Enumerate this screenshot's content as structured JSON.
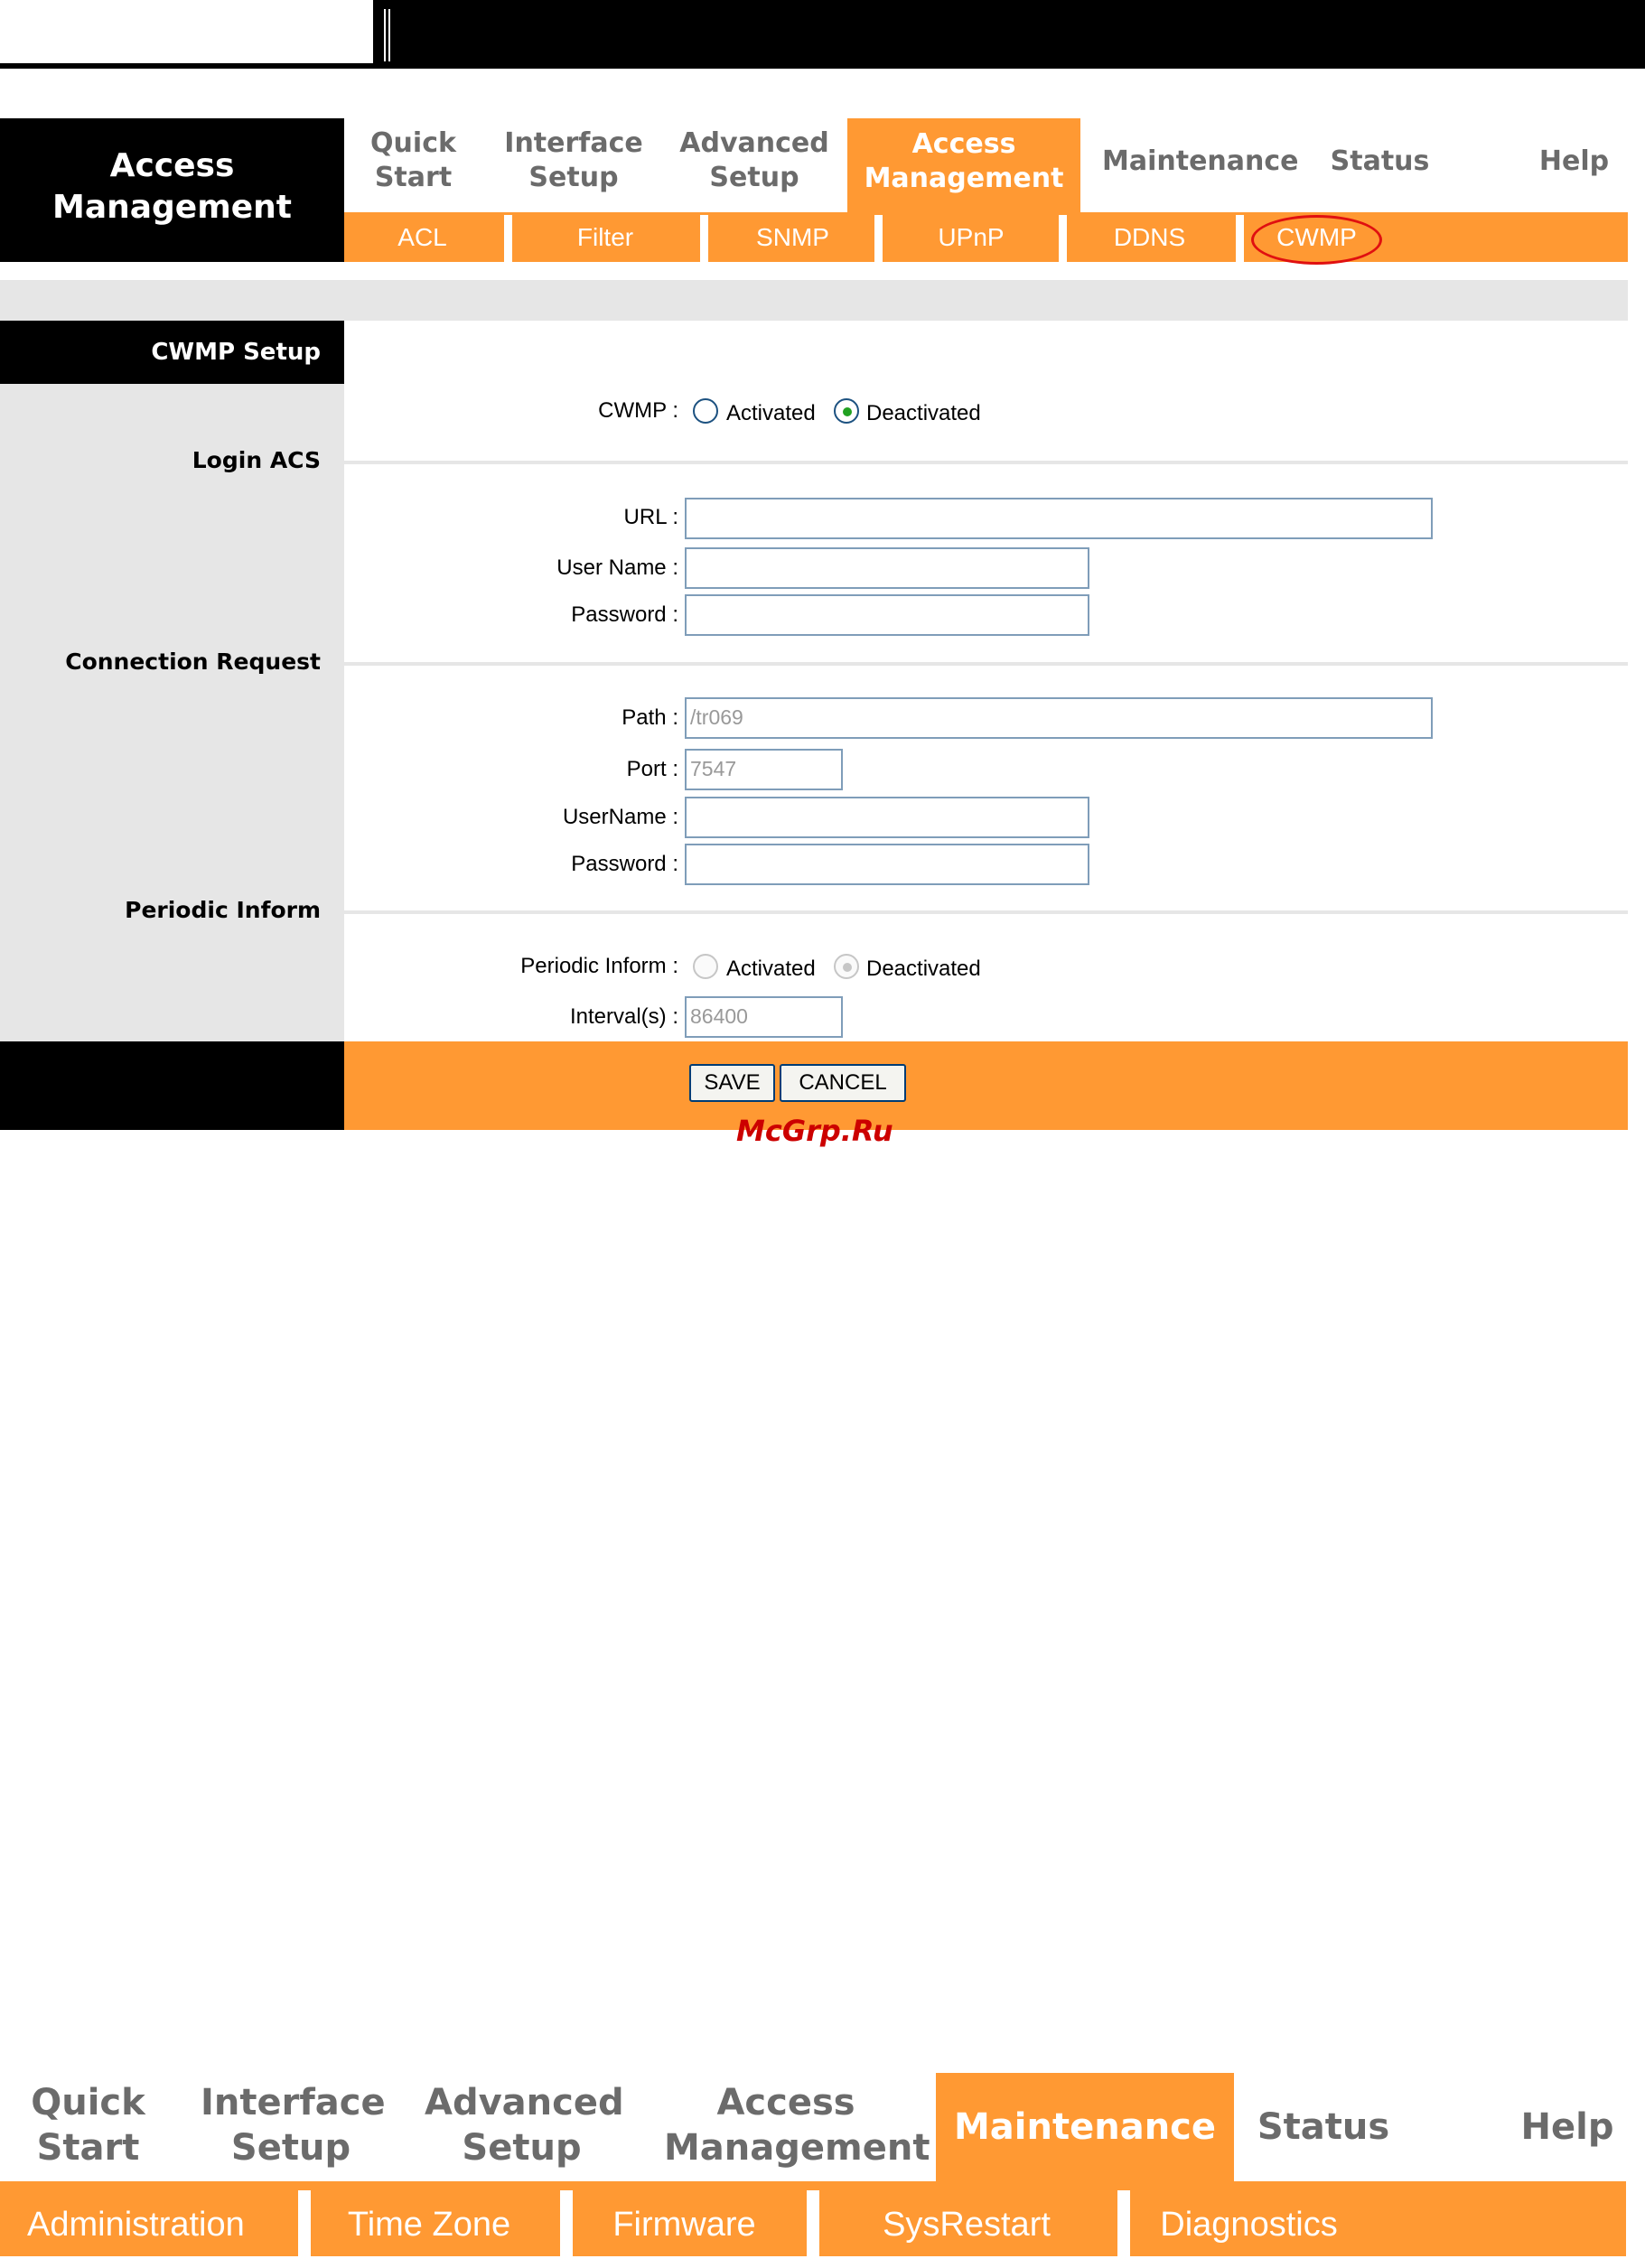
{
  "brand": {
    "line1": "Access",
    "line2": "Management"
  },
  "nav": {
    "quick_start": [
      "Quick",
      "Start"
    ],
    "interface_setup": [
      "Interface",
      "Setup"
    ],
    "advanced_setup": [
      "Advanced",
      "Setup"
    ],
    "access_management": [
      "Access",
      "Management"
    ],
    "maintenance": "Maintenance",
    "status": "Status",
    "help": "Help"
  },
  "subnav": [
    "ACL",
    "Filter",
    "SNMP",
    "UPnP",
    "DDNS",
    "CWMP"
  ],
  "panel": {
    "title": "CWMP Setup",
    "sections": {
      "login_acs": "Login ACS",
      "connection_request": "Connection Request",
      "periodic_inform": "Periodic Inform"
    },
    "cwmp_label": "CWMP :",
    "activated": "Activated",
    "deactivated": "Deactivated",
    "cwmp_selected": "Deactivated",
    "url_label": "URL :",
    "url_value": "",
    "username_label": "User Name :",
    "username_value": "",
    "password_label": "Password :",
    "password_value": "",
    "path_label": "Path :",
    "path_value": "/tr069",
    "port_label": "Port :",
    "port_value": "7547",
    "conn_username_label": "UserName :",
    "conn_username_value": "",
    "conn_password_label": "Password :",
    "conn_password_value": "",
    "periodic_label": "Periodic Inform :",
    "periodic_selected": "Deactivated",
    "interval_label": "Interval(s) :",
    "interval_value": "86400",
    "save": "SAVE",
    "cancel": "CANCEL"
  },
  "watermark": "McGrp.Ru",
  "nav2": {
    "quick_start": [
      "Quick",
      "Start"
    ],
    "interface_setup": [
      "Interface",
      "Setup"
    ],
    "advanced_setup": [
      "Advanced",
      "Setup"
    ],
    "access_management": [
      "Access",
      "Management"
    ],
    "maintenance": "Maintenance",
    "status": "Status",
    "help": "Help"
  },
  "subnav2": [
    "Administration",
    "Time Zone",
    "Firmware",
    "SysRestart",
    "Diagnostics"
  ],
  "colors": {
    "accent": "#ff9933",
    "highlight_circle": "#e01010",
    "watermark": "#cc0000"
  }
}
